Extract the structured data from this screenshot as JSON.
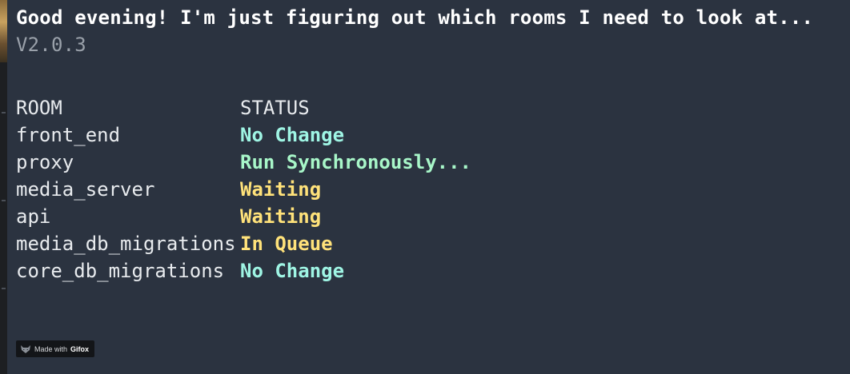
{
  "terminal": {
    "greeting": "Good evening! I'm just figuring out which rooms I need to look at...",
    "version": "V2.0.3",
    "table": {
      "headers": {
        "room": "ROOM",
        "status": "STATUS"
      },
      "rows": [
        {
          "room": "front_end",
          "status": "No Change",
          "color": "#9ff5e4"
        },
        {
          "room": "proxy",
          "status": "Run Synchronously...",
          "color": "#a8f7c9"
        },
        {
          "room": "media_server",
          "status": "Waiting",
          "color": "#ffe27a"
        },
        {
          "room": "api",
          "status": "Waiting",
          "color": "#ffe27a"
        },
        {
          "room": "media_db_migrations",
          "status": "In Queue",
          "color": "#ffe27a"
        },
        {
          "room": "core_db_migrations",
          "status": "No Change",
          "color": "#9ff5e4"
        }
      ]
    }
  },
  "watermark": {
    "prefix": "Made with",
    "brand": "Gifox",
    "icon": "fox-icon"
  },
  "colors": {
    "background": "#2b3340",
    "text": "#e8ebee",
    "muted": "#9aa1aa",
    "cyan_status": "#9ff5e4",
    "green_status": "#a8f7c9",
    "yellow_status": "#ffe27a"
  }
}
